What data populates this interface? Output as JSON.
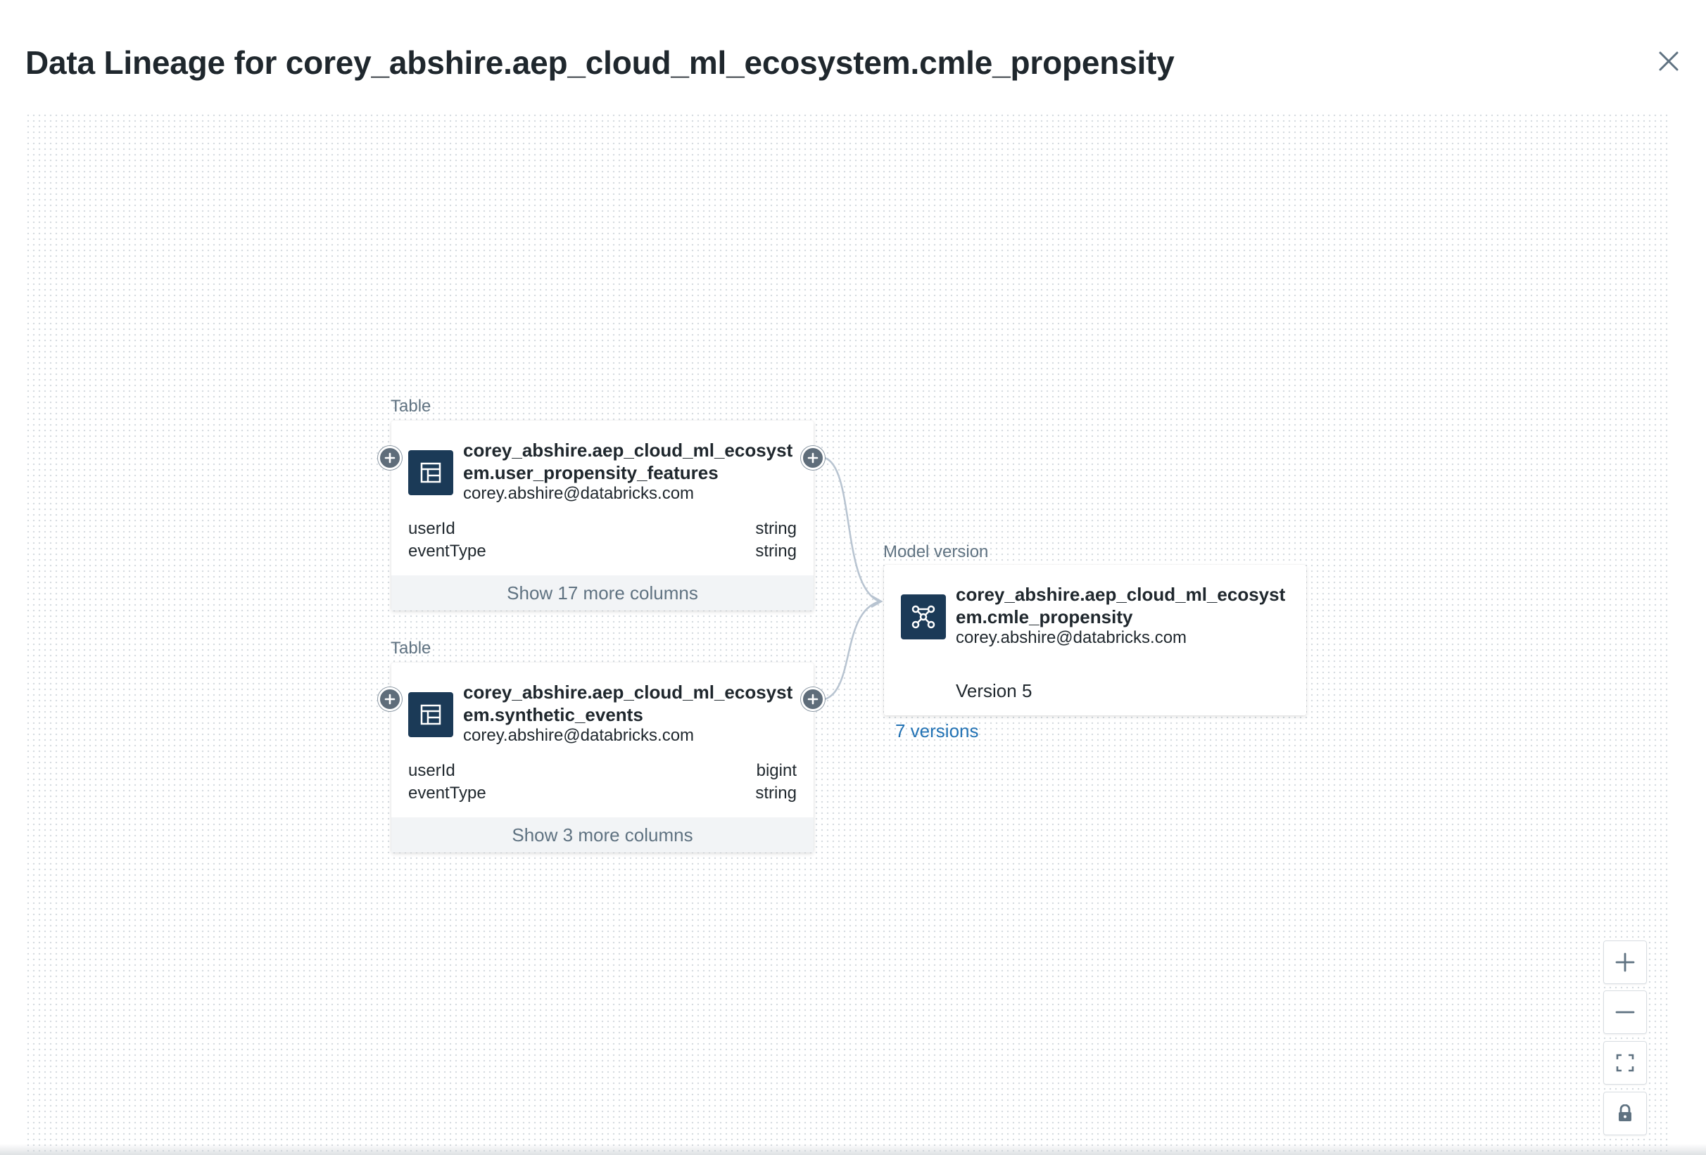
{
  "modal": {
    "title": "Data Lineage for corey_abshire.aep_cloud_ml_ecosystem.cmle_propensity",
    "close_icon": "close-icon"
  },
  "nodes": {
    "table1": {
      "type_label": "Table",
      "icon": "table-icon",
      "name": "corey_abshire.aep_cloud_ml_ecosystem.user_propensity_features",
      "owner": "corey.abshire@databricks.com",
      "columns": [
        {
          "name": "userId",
          "type": "string"
        },
        {
          "name": "eventType",
          "type": "string"
        }
      ],
      "show_more": "Show 17 more columns"
    },
    "table2": {
      "type_label": "Table",
      "icon": "table-icon",
      "name": "corey_abshire.aep_cloud_ml_ecosystem.synthetic_events",
      "owner": "corey.abshire@databricks.com",
      "columns": [
        {
          "name": "userId",
          "type": "bigint"
        },
        {
          "name": "eventType",
          "type": "string"
        }
      ],
      "show_more": "Show 3 more columns"
    },
    "model": {
      "type_label": "Model version",
      "icon": "model-icon",
      "name": "corey_abshire.aep_cloud_ml_ecosystem.cmle_propensity",
      "owner": "corey.abshire@databricks.com",
      "version": "Version 5",
      "versions_link": "7 versions"
    }
  },
  "controls": {
    "zoom_in_icon": "plus-icon",
    "zoom_out_icon": "minus-icon",
    "fit_view_icon": "fit-view-icon",
    "lock_icon": "lock-icon"
  },
  "colors": {
    "icon_bg": "#1b3a57",
    "link": "#2272b4",
    "edge": "#b8c4d1",
    "handle": "#5f6d7a"
  }
}
